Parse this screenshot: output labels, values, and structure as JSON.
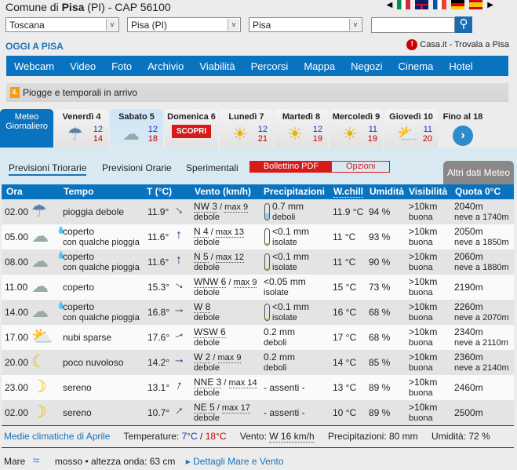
{
  "header": {
    "title_prefix": "Comune di ",
    "city": "Pisa",
    "title_suffix": " (PI) - CAP 56100",
    "flags": [
      "it",
      "en",
      "fr",
      "de",
      "es"
    ]
  },
  "selects": {
    "region": "Toscana",
    "province": "Pisa (PI)",
    "city": "Pisa"
  },
  "search": {
    "value": "",
    "icon": "search-icon"
  },
  "oggi": "OGGI A PISA",
  "casa": "Casa.it - Trovala a Pisa",
  "nav": [
    "Webcam",
    "Video",
    "Foto",
    "Archivio",
    "Viabilità",
    "Percorsi",
    "Mappa",
    "Negozi",
    "Cinema",
    "Hotel"
  ],
  "banner": "Piogge e temporali in arrivo",
  "days": [
    {
      "label": "Meteo Giornaliero"
    },
    {
      "label": "Venerdì 4",
      "min": "12",
      "max": "14",
      "icon": "rain"
    },
    {
      "label": "Sabato 5",
      "min": "12",
      "max": "18",
      "icon": "cloud",
      "selected": true
    },
    {
      "label": "Domenica 6",
      "badge": "SCOPRI"
    },
    {
      "label": "Lunedì 7",
      "min": "12",
      "max": "21",
      "icon": "sun"
    },
    {
      "label": "Martedì 8",
      "min": "12",
      "max": "19",
      "icon": "sun-haze"
    },
    {
      "label": "Mercoledì 9",
      "min": "11",
      "max": "19",
      "icon": "sun-haze"
    },
    {
      "label": "Giovedì 10",
      "min": "11",
      "max": "20",
      "icon": "sun-cloud"
    },
    {
      "label": "Fino al 18"
    }
  ],
  "subtabs": {
    "triorarie": "Previsioni Triorarie",
    "orarie": "Previsioni Orarie",
    "sperimentali": "Sperimentali",
    "pdf": "Bollettino PDF",
    "opzioni": "Opzioni",
    "altri": "Altri dati Meteo"
  },
  "columns": [
    "Ora",
    "Tempo",
    "T (°C)",
    "Vento (km/h)",
    "Precipitazioni",
    "W.chill",
    "Umidità",
    "Visibilità",
    "Quota 0°C"
  ],
  "rows": [
    {
      "ora": "02.00",
      "icon": "rain",
      "tempo": "pioggia debole",
      "tempo2": "",
      "drop": false,
      "t": "11.9°",
      "dir": "NW",
      "wind": "NW 3",
      "max": "max 9",
      "wdesc": "debole",
      "prec": "0.7 mm",
      "pdesc": "deboli",
      "tube": 0.4,
      "wc": "11.9 °C",
      "hum": "94 %",
      "vis": ">10km",
      "vdesc": "buona",
      "quota": "2040m",
      "neve": "neve a 1740m"
    },
    {
      "ora": "05.00",
      "icon": "cloud",
      "tempo": "coperto",
      "tempo2": "con qualche pioggia",
      "drop": true,
      "t": "11.6°",
      "dir": "N",
      "wind": "N 4",
      "max": "max 13",
      "wdesc": "debole",
      "prec": "<0.1 mm",
      "pdesc": "isolate",
      "tube": 0.1,
      "wc": "11 °C",
      "hum": "93 %",
      "vis": ">10km",
      "vdesc": "buona",
      "quota": "2050m",
      "neve": "neve a 1850m"
    },
    {
      "ora": "08.00",
      "icon": "cloud",
      "tempo": "coperto",
      "tempo2": "con qualche pioggia",
      "drop": true,
      "t": "11.6°",
      "dir": "N",
      "wind": "N 5",
      "max": "max 12",
      "wdesc": "debole",
      "prec": "<0.1 mm",
      "pdesc": "isolate",
      "tube": 0.1,
      "wc": "11 °C",
      "hum": "90 %",
      "vis": ">10km",
      "vdesc": "buona",
      "quota": "2060m",
      "neve": "neve a 1880m"
    },
    {
      "ora": "11.00",
      "icon": "cloud",
      "tempo": "coperto",
      "tempo2": "",
      "drop": false,
      "t": "15.3°",
      "dir": "WNW",
      "wind": "WNW 6",
      "max": "max 9",
      "wdesc": "debole",
      "prec": "<0.05 mm",
      "pdesc": "isolate",
      "tube": null,
      "wc": "15 °C",
      "hum": "73 %",
      "vis": ">10km",
      "vdesc": "buona",
      "quota": "2190m",
      "neve": ""
    },
    {
      "ora": "14.00",
      "icon": "cloud",
      "tempo": "coperto",
      "tempo2": "con qualche pioggia",
      "drop": true,
      "t": "16.8°",
      "dir": "W",
      "wind": "W 8",
      "max": "",
      "wdesc": "debole",
      "prec": "<0.1 mm",
      "pdesc": "isolate",
      "tube": 0.1,
      "wc": "16 °C",
      "hum": "68 %",
      "vis": ">10km",
      "vdesc": "buona",
      "quota": "2260m",
      "neve": "neve a 2070m"
    },
    {
      "ora": "17.00",
      "icon": "sun-cloud",
      "tempo": "nubi sparse",
      "tempo2": "",
      "drop": false,
      "t": "17.6°",
      "dir": "WSW",
      "wind": "WSW 6",
      "max": "",
      "wdesc": "debole",
      "prec": "0.2 mm",
      "pdesc": "deboli",
      "tube": null,
      "wc": "17 °C",
      "hum": "68 %",
      "vis": ">10km",
      "vdesc": "buona",
      "quota": "2340m",
      "neve": "neve a 2110m"
    },
    {
      "ora": "20.00",
      "icon": "moon-cloud",
      "tempo": "poco nuvoloso",
      "tempo2": "",
      "drop": false,
      "t": "14.2°",
      "dir": "W",
      "wind": "W 2",
      "max": "max 9",
      "wdesc": "debole",
      "prec": "0.2 mm",
      "pdesc": "deboli",
      "tube": null,
      "wc": "14 °C",
      "hum": "85 %",
      "vis": ">10km",
      "vdesc": "buona",
      "quota": "2360m",
      "neve": "neve a 2140m"
    },
    {
      "ora": "23.00",
      "icon": "moon",
      "tempo": "sereno",
      "tempo2": "",
      "drop": false,
      "t": "13.1°",
      "dir": "NNE",
      "wind": "NNE 3",
      "max": "max 14",
      "wdesc": "debole",
      "prec": "- assenti -",
      "pdesc": "",
      "tube": null,
      "wc": "13 °C",
      "hum": "89 %",
      "vis": ">10km",
      "vdesc": "buona",
      "quota": "2460m",
      "neve": ""
    },
    {
      "ora": "02.00",
      "icon": "moon",
      "tempo": "sereno",
      "tempo2": "",
      "drop": false,
      "t": "10.7°",
      "dir": "NE",
      "wind": "NE 5",
      "max": "max 17",
      "wdesc": "debole",
      "prec": "- assenti -",
      "pdesc": "",
      "tube": null,
      "wc": "10 °C",
      "hum": "89 %",
      "vis": ">10km",
      "vdesc": "buona",
      "quota": "2500m",
      "neve": ""
    }
  ],
  "medie": {
    "label": "Medie climatiche di Aprile",
    "temp_label": "Temperature: ",
    "tmin": "7°C",
    "sep": " / ",
    "tmax": "18°C",
    "vento_label": "Vento: ",
    "vento": "W 16 km/h",
    "prec": "Precipitazioni: 80 mm",
    "umid": "Umidità: 72 %"
  },
  "mare": {
    "label": "Mare",
    "stato": "mosso",
    "onda": "altezza onda: 63 cm",
    "link": "Dettagli Mare e Vento"
  },
  "colors": {
    "brand": "#0a73bf",
    "red": "#d91a1a",
    "min": "#1a2fc0",
    "max": "#b00000"
  }
}
